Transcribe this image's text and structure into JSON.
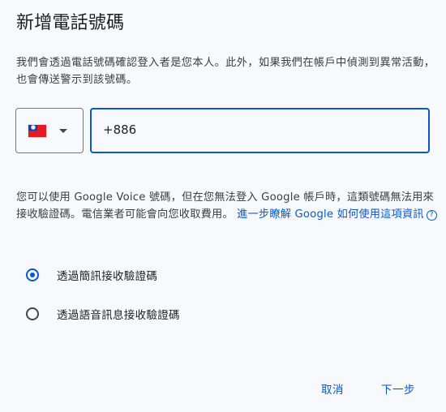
{
  "dialog": {
    "title": "新增電話號碼",
    "description": "我們會透過電話號碼確認登入者是您本人。此外，如果我們在帳戶中偵測到異常活動，也會傳送警示到該號碼。"
  },
  "phone": {
    "country_flag": "taiwan-flag",
    "value": "+886"
  },
  "info": {
    "text": "您可以使用 Google Voice 號碼，但在您無法登入 Google 帳戶時，這類號碼無法用來接收驗證碼。電信業者可能會向您收取費用。",
    "link": "進一步瞭解 Google 如何使用這項資訊",
    "help_icon_glyph": "?"
  },
  "options": [
    {
      "label": "透過簡訊接收驗證碼",
      "checked": true
    },
    {
      "label": "透過語音訊息接收驗證碼",
      "checked": false
    }
  ],
  "actions": {
    "cancel_label": "取消",
    "next_label": "下一步"
  },
  "colors": {
    "accent": "#0b57d0",
    "background": "#f7f9fc",
    "text": "#1f1f1f",
    "secondary_text": "#3c4043"
  }
}
